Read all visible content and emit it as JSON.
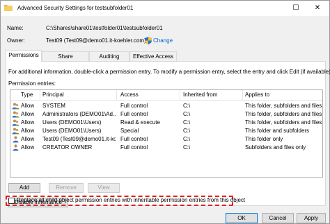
{
  "window": {
    "title": "Advanced Security Settings for testsubfolder01",
    "maximize_glyph": "☐",
    "close_glyph": "✕"
  },
  "info": {
    "name_label": "Name:",
    "name_value": "C:\\Shares\\share01\\testfolder01\\testsubfolder01",
    "owner_label": "Owner:",
    "owner_value": "Test09 (Test09@demo01.it-koehler.com)",
    "change_label": "Change"
  },
  "tabs": [
    {
      "label": "Permissions",
      "active": true
    },
    {
      "label": "Share",
      "active": false
    },
    {
      "label": "Auditing",
      "active": false
    },
    {
      "label": "Effective Access",
      "active": false
    }
  ],
  "panel": {
    "instructions": "For additional information, double-click a permission entry. To modify a permission entry, select the entry and click Edit (if available).",
    "entries_label": "Permission entries:"
  },
  "grid": {
    "columns": [
      "Type",
      "Principal",
      "Access",
      "Inherited from",
      "Applies to"
    ],
    "rows": [
      {
        "type": "Allow",
        "principal": "SYSTEM",
        "access": "Full control",
        "inherited": "C:\\",
        "applies": "This folder, subfolders and files"
      },
      {
        "type": "Allow",
        "principal": "Administrators (DEMO01\\Ad...",
        "access": "Full control",
        "inherited": "C:\\",
        "applies": "This folder, subfolders and files"
      },
      {
        "type": "Allow",
        "principal": "Users (DEMO01\\Users)",
        "access": "Read & execute",
        "inherited": "C:\\",
        "applies": "This folder, subfolders and files"
      },
      {
        "type": "Allow",
        "principal": "Users (DEMO01\\Users)",
        "access": "Special",
        "inherited": "C:\\",
        "applies": "This folder and subfolders"
      },
      {
        "type": "Allow",
        "principal": "Test09 (Test09@demo01.it-ko...",
        "access": "Full control",
        "inherited": "C:\\",
        "applies": "This folder only"
      },
      {
        "type": "Allow",
        "principal": "CREATOR OWNER",
        "access": "Full control",
        "inherited": "C:\\",
        "applies": "Subfolders and files only"
      }
    ]
  },
  "buttons": {
    "add": "Add",
    "remove": "Remove",
    "view": "View",
    "disable_inheritance": "Disable inheritance",
    "ok": "OK",
    "cancel": "Cancel",
    "apply": "Apply"
  },
  "replace_checkbox": {
    "label": "Replace all child object permission entries with inheritable permission entries from this object",
    "checked": false
  },
  "colors": {
    "highlight_dash": "#e41c1c",
    "link": "#0066cc",
    "default_button_border": "#0078d7"
  }
}
